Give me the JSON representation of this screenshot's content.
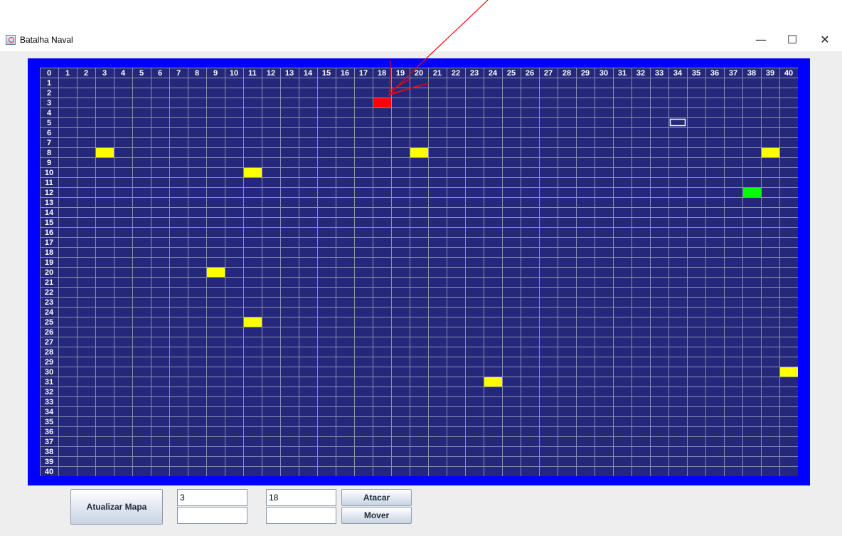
{
  "window": {
    "title": "Batalha Naval",
    "controls": {
      "minimize": "—",
      "maximize": "☐",
      "close": "✕"
    }
  },
  "board": {
    "columns": [
      "0",
      "1",
      "2",
      "3",
      "4",
      "5",
      "6",
      "7",
      "8",
      "9",
      "10",
      "11",
      "12",
      "13",
      "14",
      "15",
      "16",
      "17",
      "18",
      "19",
      "20",
      "21",
      "22",
      "23",
      "24",
      "25",
      "26",
      "27",
      "28",
      "29",
      "30",
      "31",
      "32",
      "33",
      "34",
      "35",
      "36",
      "37",
      "38",
      "39",
      "40"
    ],
    "rows": [
      "0",
      "1",
      "2",
      "3",
      "4",
      "5",
      "6",
      "7",
      "8",
      "9",
      "10",
      "11",
      "12",
      "13",
      "14",
      "15",
      "16",
      "17",
      "18",
      "19",
      "20",
      "21",
      "22",
      "23",
      "24",
      "25",
      "26",
      "27",
      "28",
      "29",
      "30",
      "31",
      "32",
      "33",
      "34",
      "35",
      "36",
      "37",
      "38",
      "39",
      "40"
    ],
    "colors": {
      "water": "#25287a",
      "grid_line": "#8890b0",
      "frame": "#0000ff",
      "header_text": "#ffffff"
    },
    "marked_cells": [
      {
        "row": 3,
        "col": 18,
        "color": "#ff0000",
        "kind": "attack"
      },
      {
        "row": 5,
        "col": 34,
        "color": "#25287a",
        "kind": "selected"
      },
      {
        "row": 8,
        "col": 3,
        "color": "#ffff00",
        "kind": "ship"
      },
      {
        "row": 8,
        "col": 20,
        "color": "#ffff00",
        "kind": "ship"
      },
      {
        "row": 8,
        "col": 39,
        "color": "#ffff00",
        "kind": "ship"
      },
      {
        "row": 10,
        "col": 11,
        "color": "#ffff00",
        "kind": "ship"
      },
      {
        "row": 12,
        "col": 38,
        "color": "#00ff00",
        "kind": "player-ship"
      },
      {
        "row": 20,
        "col": 9,
        "color": "#ffff00",
        "kind": "ship"
      },
      {
        "row": 25,
        "col": 11,
        "color": "#ffff00",
        "kind": "ship"
      },
      {
        "row": 30,
        "col": 40,
        "color": "#ffff00",
        "kind": "ship"
      },
      {
        "row": 31,
        "col": 24,
        "color": "#ffff00",
        "kind": "ship"
      }
    ]
  },
  "controls": {
    "refresh_label": "Atualizar Mapa",
    "attack_label": "Atacar",
    "move_label": "Mover",
    "attack_row_value": "3",
    "attack_col_value": "18",
    "move_row_value": "",
    "move_col_value": ""
  },
  "annotation": {
    "color": "#ff0000"
  }
}
